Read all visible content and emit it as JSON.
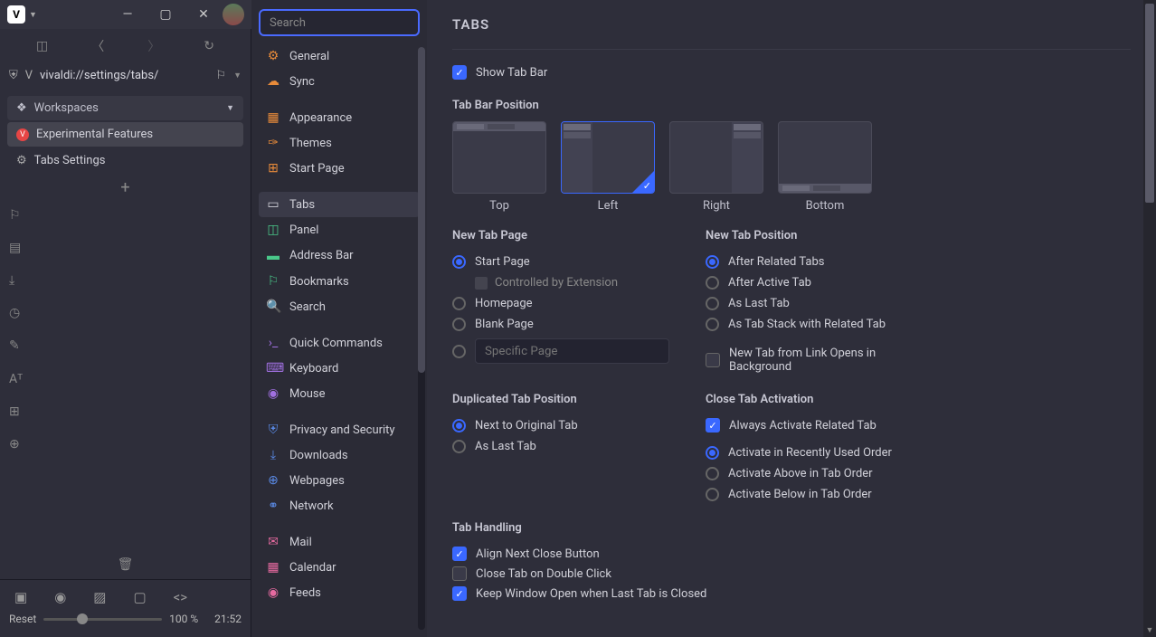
{
  "titlebar": {
    "logo": "V"
  },
  "address": {
    "url": "vivaldi://settings/tabs/"
  },
  "workspaces": {
    "header": "Workspaces",
    "tab1": "Experimental Features",
    "tab2": "Tabs Settings"
  },
  "bottombar": {
    "reset": "Reset",
    "zoom": "100 %",
    "time": "21:52"
  },
  "search": {
    "placeholder": "Search"
  },
  "nav": {
    "general": "General",
    "sync": "Sync",
    "appearance": "Appearance",
    "themes": "Themes",
    "startpage": "Start Page",
    "tabs": "Tabs",
    "panel": "Panel",
    "addressbar": "Address Bar",
    "bookmarks": "Bookmarks",
    "search": "Search",
    "quickcommands": "Quick Commands",
    "keyboard": "Keyboard",
    "mouse": "Mouse",
    "privacy": "Privacy and Security",
    "downloads": "Downloads",
    "webpages": "Webpages",
    "network": "Network",
    "mail": "Mail",
    "calendar": "Calendar",
    "feeds": "Feeds"
  },
  "main": {
    "title": "TABS",
    "showTabBar": "Show Tab Bar",
    "tabBarPosition": "Tab Bar Position",
    "pos": {
      "top": "Top",
      "left": "Left",
      "right": "Right",
      "bottom": "Bottom"
    },
    "newTabPage": {
      "title": "New Tab Page",
      "startPage": "Start Page",
      "controlled": "Controlled by Extension",
      "homepage": "Homepage",
      "blank": "Blank Page",
      "specific": "Specific Page"
    },
    "newTabPosition": {
      "title": "New Tab Position",
      "afterRelated": "After Related Tabs",
      "afterActive": "After Active Tab",
      "asLast": "As Last Tab",
      "asStack": "As Tab Stack with Related Tab",
      "linkBg": "New Tab from Link Opens in Background"
    },
    "dupPos": {
      "title": "Duplicated Tab Position",
      "nextTo": "Next to Original Tab",
      "asLast": "As Last Tab"
    },
    "closeAct": {
      "title": "Close Tab Activation",
      "always": "Always Activate Related Tab",
      "recent": "Activate in Recently Used Order",
      "above": "Activate Above in Tab Order",
      "below": "Activate Below in Tab Order"
    },
    "handling": {
      "title": "Tab Handling",
      "align": "Align Next Close Button",
      "dblclick": "Close Tab on Double Click",
      "keepOpen": "Keep Window Open when Last Tab is Closed"
    }
  }
}
